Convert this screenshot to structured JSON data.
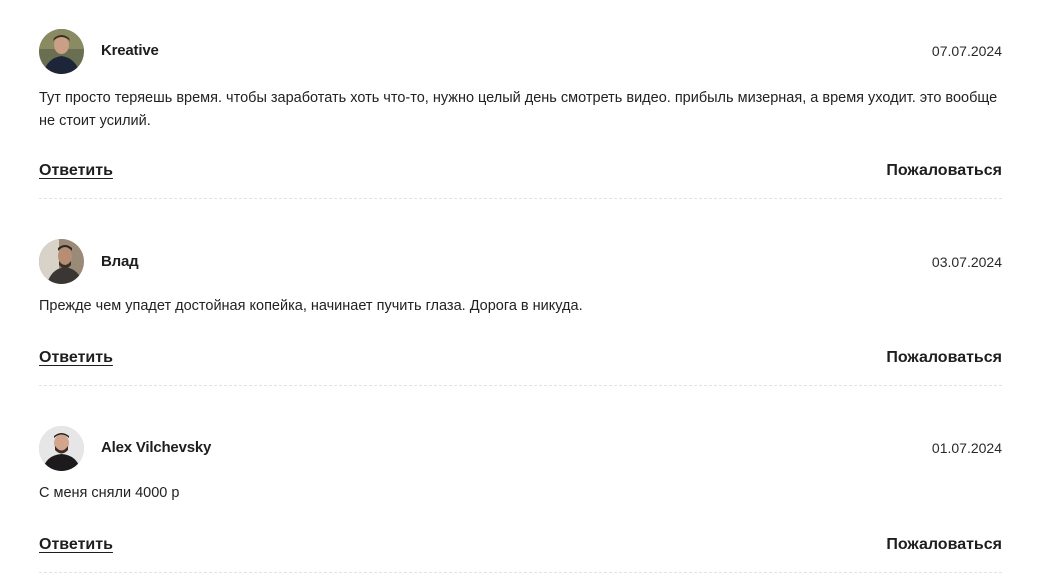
{
  "comments": [
    {
      "author": "Kreative",
      "date": "07.07.2024",
      "text": "Тут просто теряешь время. чтобы заработать хоть что-то, нужно целый день смотреть видео. прибыль мизерная, а время уходит. это вообще не стоит усилий.",
      "reply_label": "Ответить",
      "report_label": "Пожаловаться"
    },
    {
      "author": "Влад",
      "date": "03.07.2024",
      "text": "Прежде чем упадет достойная копейка, начинает пучить глаза. Дорога в никуда.",
      "reply_label": "Ответить",
      "report_label": "Пожаловаться"
    },
    {
      "author": "Alex Vilchevsky",
      "date": "01.07.2024",
      "text": "С меня сняли 4000 р",
      "reply_label": "Ответить",
      "report_label": "Пожаловаться"
    }
  ]
}
